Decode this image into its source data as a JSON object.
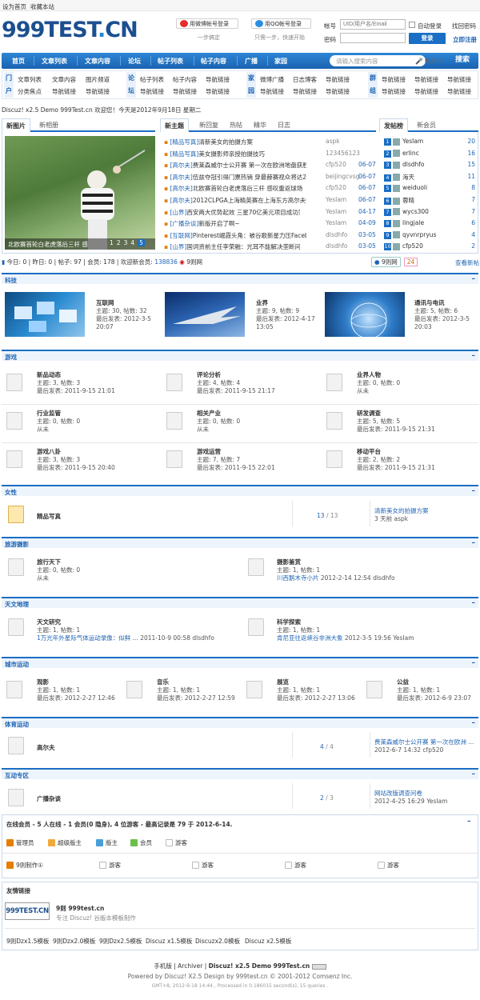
{
  "topbar": {
    "set_home": "设为首页",
    "bookmark": "收藏本站"
  },
  "logo": {
    "text_a": "999TEST",
    "dot": ".",
    "text_b": "CN"
  },
  "login": {
    "weibo_btn": "用微博帐号登录",
    "qq_btn": "用QQ帐号登录",
    "weibo_sub": "一步搞定",
    "qq_sub": "只需一步，快速开始",
    "account_label": "帐号",
    "account_placeholder": "UID/用户名/Email",
    "auto_login": "自动登录",
    "forgot": "找回密码",
    "password_label": "密码",
    "login_btn": "登录",
    "register": "立即注册"
  },
  "nav": {
    "items": [
      "首页",
      "文章列表",
      "文章内容",
      "论坛",
      "帖子列表",
      "帖子内容",
      "广播",
      "家园"
    ],
    "search_placeholder": "请输入搜索内容",
    "search_type": "帖子",
    "search_btn": "搜索"
  },
  "subnav": {
    "groups": [
      {
        "tag": "门户",
        "rows": [
          [
            "文章列表",
            "文章内容",
            "图片频道"
          ],
          [
            "分类焦点",
            "导航链接",
            "导航链接"
          ]
        ]
      },
      {
        "tag": "论坛",
        "rows": [
          [
            "帖子列表",
            "帖子内容",
            "导航链接"
          ],
          [
            "导航链接",
            "导航链接",
            "导航链接"
          ]
        ]
      },
      {
        "tag": "家园",
        "rows": [
          [
            "微博广播",
            "日志博客",
            "导航链接"
          ],
          [
            "导航链接",
            "导航链接",
            "导航链接"
          ]
        ]
      },
      {
        "tag": "群组",
        "rows": [
          [
            "导航链接",
            "导航链接",
            "导航链接"
          ],
          [
            "导航链接",
            "导航链接",
            "导航链接"
          ]
        ]
      }
    ]
  },
  "ticker": {
    "text": "Discuz! x2.5 Demo 999Test.cn 欢迎您！今天是2012年9月18日 星期二"
  },
  "tabs_left": [
    "新图片",
    "新相册"
  ],
  "tabs_mid": [
    "新主题",
    "新回复",
    "热帖",
    "精华",
    "日志"
  ],
  "tabs_right": [
    "发帖榜",
    "新会员"
  ],
  "slide": {
    "caption": "北欧赛首轮白老虎落后三杆 感",
    "pages": [
      "1",
      "2",
      "3",
      "4",
      "5"
    ]
  },
  "threads": [
    {
      "tag": "[精品写真]",
      "title": "清新美女的拍摄方案",
      "author": "aspk",
      "date": ""
    },
    {
      "tag": "[精品写真]",
      "title": "美女摄影师亲授拍摄技巧",
      "author": "123456123",
      "date": ""
    },
    {
      "tag": "[高尔夫]",
      "title": "费莱森威尔士公开赛 第一次在欧洲地盘获胜",
      "author": "cfp520",
      "date": "06-07"
    },
    {
      "tag": "[高尔夫]",
      "title": "伍兹夺冠引得门票热销 穿最薛赛视众将达25万",
      "author": "beijingcvsg",
      "date": "06-07"
    },
    {
      "tag": "[高尔夫]",
      "title": "北欧赛首轮白老虎落后三杆 感叹重返球场",
      "author": "cfp520",
      "date": "06-07"
    },
    {
      "tag": "[高尔夫]",
      "title": "2012CLPGA上海精英赛在上海东方高尔夫俱乐部",
      "author": "YesIam",
      "date": "06-07"
    },
    {
      "tag": "[山界]",
      "title": "西安两大优势起效 三星70亿美元项目成功落户",
      "author": "YesIam",
      "date": "04-17"
    },
    {
      "tag": "[广播杂谈]",
      "title": "新版开启了啊~",
      "author": "YesIam",
      "date": "04-09"
    },
    {
      "tag": "[互联网]",
      "title": "Pinterest崛霞头角：被谷歌新星力压Facebook",
      "author": "dlsdhfo",
      "date": "03-05"
    },
    {
      "tag": "[山界]",
      "title": "国词资前主任李荣融：光耳不能解决垄断问题",
      "author": "dlsdhfo",
      "date": "03-05"
    }
  ],
  "ranks": [
    {
      "n": "1",
      "name": "YesIam",
      "count": "20"
    },
    {
      "n": "2",
      "name": "erlinc",
      "count": "16"
    },
    {
      "n": "3",
      "name": "dlsdhfo",
      "count": "15"
    },
    {
      "n": "4",
      "name": "海天",
      "count": "11"
    },
    {
      "n": "5",
      "name": "weiduoli",
      "count": "8"
    },
    {
      "n": "6",
      "name": "蓉晴",
      "count": "7"
    },
    {
      "n": "7",
      "name": "wycs300",
      "count": "7"
    },
    {
      "n": "8",
      "name": "lingjale",
      "count": "6"
    },
    {
      "n": "9",
      "name": "qyvnrpryus",
      "count": "4"
    },
    {
      "n": "10",
      "name": "cfp520",
      "count": "2"
    }
  ],
  "stats": {
    "today": "今日: 0",
    "yesterday": "昨日: 0",
    "threads": "帖子: 97",
    "members": "会员: 178",
    "welcome": "欢迎新会员:",
    "newmember": "138836",
    "weibo": "9则网",
    "badge": "9则网",
    "badge_num": "24",
    "view_new": "查看新帖"
  },
  "sections": [
    {
      "title": "科技",
      "boards": [
        {
          "name": "互联网",
          "l1": "主题: 30, 帖数: 32",
          "l2": "最后发表: 2012-3-5",
          "l3": "20:07"
        },
        {
          "name": "业界",
          "l1": "主题: 9, 帖数: 9",
          "l2": "最后发表: 2012-4-17",
          "l3": "13:05"
        },
        {
          "name": "通讯与电讯",
          "l1": "主题: 5, 帖数: 6",
          "l2": "最后发表: 2012-3-5",
          "l3": "20:03"
        }
      ]
    },
    {
      "title": "游戏",
      "boards": [
        {
          "name": "新品动态",
          "l1": "主题: 3, 帖数: 3",
          "l2": "最后发表: 2011-9-15 21:01"
        },
        {
          "name": "评论分析",
          "l1": "主题: 4, 帖数: 4",
          "l2": "最后发表: 2011-9-15 21:17"
        },
        {
          "name": "业界人物",
          "l1": "主题: 0, 帖数: 0",
          "l2": "从未"
        },
        {
          "name": "行业监管",
          "l1": "主题: 0, 帖数: 0",
          "l2": "从未"
        },
        {
          "name": "相关产业",
          "l1": "主题: 0, 帖数: 0",
          "l2": "从未"
        },
        {
          "name": "研发调查",
          "l1": "主题: 5, 帖数: 5",
          "l2": "最后发表: 2011-9-15 21:31"
        },
        {
          "name": "游戏八卦",
          "l1": "主题: 3, 帖数: 3",
          "l2": "最后发表: 2011-9-15 20:40"
        },
        {
          "name": "游戏运营",
          "l1": "主题: 7, 帖数: 7",
          "l2": "最后发表: 2011-9-15 22:01"
        },
        {
          "name": "移动平台",
          "l1": "主题: 2, 帖数: 2",
          "l2": "最后发表: 2011-9-15 21:31"
        }
      ]
    },
    {
      "title": "女性",
      "name": "精品写真",
      "count": "13",
      "count2": "13",
      "last": "清新美女的拍摄方案",
      "last2": "3 天前 aspk"
    },
    {
      "title": "旅游摄影",
      "boards": [
        {
          "name": "旅行天下",
          "l1": "主题: 0, 帖数: 0",
          "l2": "从未"
        },
        {
          "name": "摄影鉴赏",
          "l1": "主题: 1, 帖数: 1",
          "l2a": "川西鹅木寺小片",
          "l2b": "2012-2-14 12:54 dlsdhfo"
        }
      ]
    },
    {
      "title": "天文地理",
      "boards": [
        {
          "name": "天文研究",
          "l1": "主题: 1, 帖数: 1",
          "l2a": "1万光年外星际气体运动录像：似鲜 ...",
          "l2b": "2011-10-9 00:58 dlsdhfo"
        },
        {
          "name": "科学探索",
          "l1": "主题: 1, 帖数: 1",
          "l2a": "肯尼亚往返峡谷非洲大象",
          "l2b": "2012-3-5 19:56 YesIam"
        }
      ]
    },
    {
      "title": "城市运动",
      "boards": [
        {
          "name": "观影",
          "l1": "主题: 1, 帖数: 1",
          "l2": "最后发表: 2012-2-27 12:46"
        },
        {
          "name": "音乐",
          "l1": "主题: 1, 帖数: 1",
          "l2": "最后发表: 2012-2-27 12:59"
        },
        {
          "name": "展览",
          "l1": "主题: 1, 帖数: 1",
          "l2": "最后发表: 2012-2-27 13:06"
        },
        {
          "name": "公益",
          "l1": "主题: 1, 帖数: 1",
          "l2": "最后发表: 2012-6-9 23:07"
        }
      ]
    },
    {
      "title": "体育运动",
      "name": "高尔夫",
      "count": "4",
      "count2": "4",
      "last": "费莱森威尔士公开赛 第一次在欧洲 ...",
      "last2": "2012-6-7 14:32 cfp520"
    },
    {
      "title": "互动专区",
      "name": "广播杂谈",
      "count": "2",
      "count2": "3",
      "last": "网站改版调查问卷",
      "last2": "2012-4-25 16:29 YesIam"
    }
  ],
  "online": {
    "title": "在线会员 - 5 人在线 - 1 会员(0 隐身), 4 位游客 - 最高记录是 79 于 2012-6-14.",
    "legend": [
      "管理员",
      "超级版主",
      "版主",
      "会员",
      "游客"
    ],
    "users": [
      "9则制作①",
      "游客",
      "游客",
      "游客",
      "游客"
    ]
  },
  "friends": {
    "title": "友情链接",
    "logo": "999TEST.CN",
    "site": "9则 999test.cn",
    "desc": "专注 Discuz! 谷版本模板制作",
    "links": [
      "9则Dzx1.5模板",
      "9则Dzx2.0模板",
      "9则Dzx2.5模板",
      "Discuz x1.5模板",
      "Discuzx2.0模板",
      "Discuz x2.5模板"
    ]
  },
  "footer": {
    "l1a": "手机版",
    "l1b": "Archiver",
    "l1c": "Discuz! x2.5 Demo 999Test.cn",
    "l2": "Powered by Discuz! X2.5 Design by 999test.cn © 2001-2012 Comsenz Inc.",
    "l3": "GMT+8, 2012-9-18 14:44 , Processed in 0.186015 second(s), 15 queries ."
  },
  "colors": {
    "brand": "#1a6ec4",
    "nav": "#1f6dbf",
    "accent": "#e67e00"
  }
}
